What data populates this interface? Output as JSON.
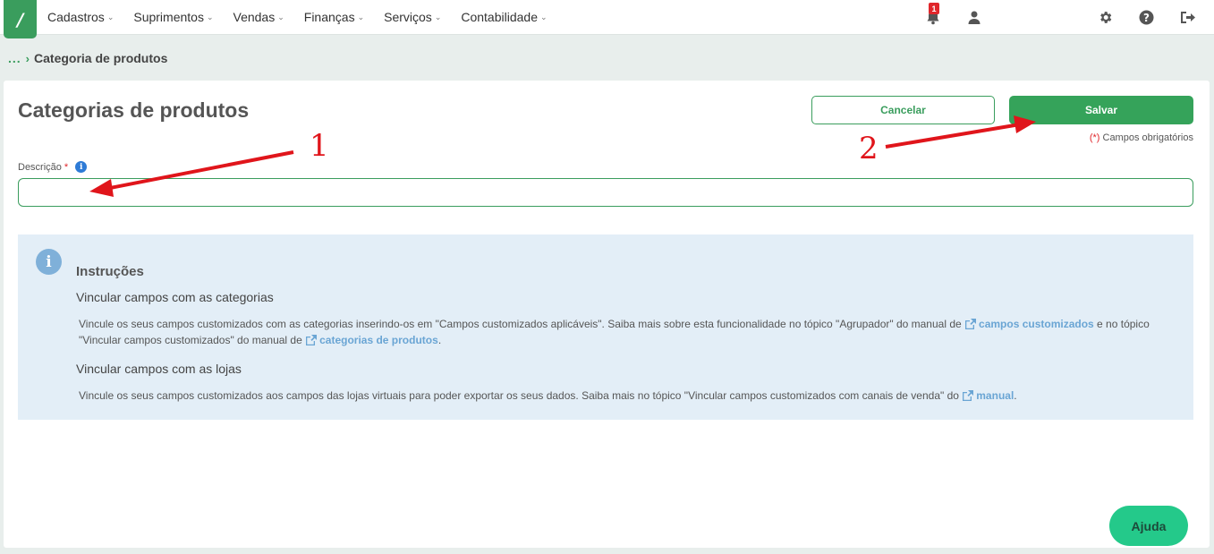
{
  "app": {
    "logo_glyph": "/"
  },
  "nav": {
    "menu": [
      {
        "label": "Cadastros"
      },
      {
        "label": "Suprimentos"
      },
      {
        "label": "Vendas"
      },
      {
        "label": "Finanças"
      },
      {
        "label": "Serviços"
      },
      {
        "label": "Contabilidade"
      }
    ],
    "notifications_count": "1"
  },
  "breadcrumb": {
    "ellipsis": "...",
    "current": "Categoria de produtos"
  },
  "page": {
    "title": "Categorias de produtos",
    "cancel_label": "Cancelar",
    "save_label": "Salvar",
    "required_mark": "(*)",
    "required_note": "Campos obrigatórios",
    "field_label": "Descrição",
    "field_required": "*",
    "field_value": ""
  },
  "instructions": {
    "title": "Instruções",
    "section1_title": "Vincular campos com as categorias",
    "section1_text_a": "Vincule os seus campos customizados com as categorias inserindo-os em \"Campos customizados aplicáveis\". Saiba mais sobre esta funcionalidade no tópico \"Agrupador\" do manual de ",
    "section1_link1": "campos customizados",
    "section1_text_b": " e no tópico \"Vincular campos customizados\" do manual de ",
    "section1_link2": "categorias de produtos",
    "section1_text_c": ".",
    "section2_title": "Vincular campos com as lojas",
    "section2_text_a": "Vincule os seus campos customizados aos campos das lojas virtuais para poder exportar os seus dados. Saiba mais no tópico \"Vincular campos customizados com canais de venda\" do ",
    "section2_link": "manual",
    "section2_text_b": "."
  },
  "help": {
    "label": "Ajuda"
  },
  "annotations": {
    "first": "1",
    "second": "2"
  },
  "colors": {
    "brand": "#3a9d5d",
    "info_bg": "#e3eef7",
    "arrow": "#e0151b",
    "help": "#24c98a"
  }
}
